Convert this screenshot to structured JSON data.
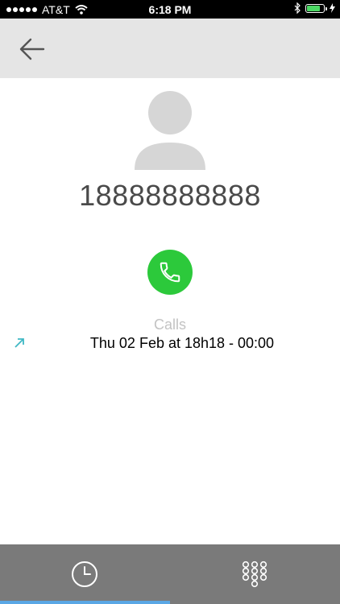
{
  "status_bar": {
    "carrier": "AT&T",
    "time": "6:18 PM",
    "battery_level": 0.8
  },
  "header": {
    "back_icon": "back-arrow-icon"
  },
  "contact": {
    "avatar_icon": "person-avatar-icon",
    "number": "18888888888",
    "call_icon": "phone-icon"
  },
  "calls": {
    "label": "Calls",
    "entries": [
      {
        "direction_icon": "outgoing-arrow-icon",
        "text": "Thu 02 Feb at 18h18 - 00:00"
      }
    ]
  },
  "tab_bar": {
    "tabs": [
      {
        "icon": "clock-icon",
        "selected": true
      },
      {
        "icon": "dialpad-icon",
        "selected": false
      }
    ],
    "colors": {
      "background": "#7a7a7a",
      "indicator": "#5aa7e5"
    }
  },
  "colors": {
    "call_button": "#2cc93b",
    "header_background": "#e5e5e5",
    "arrow_accent": "#3fb8c4"
  }
}
